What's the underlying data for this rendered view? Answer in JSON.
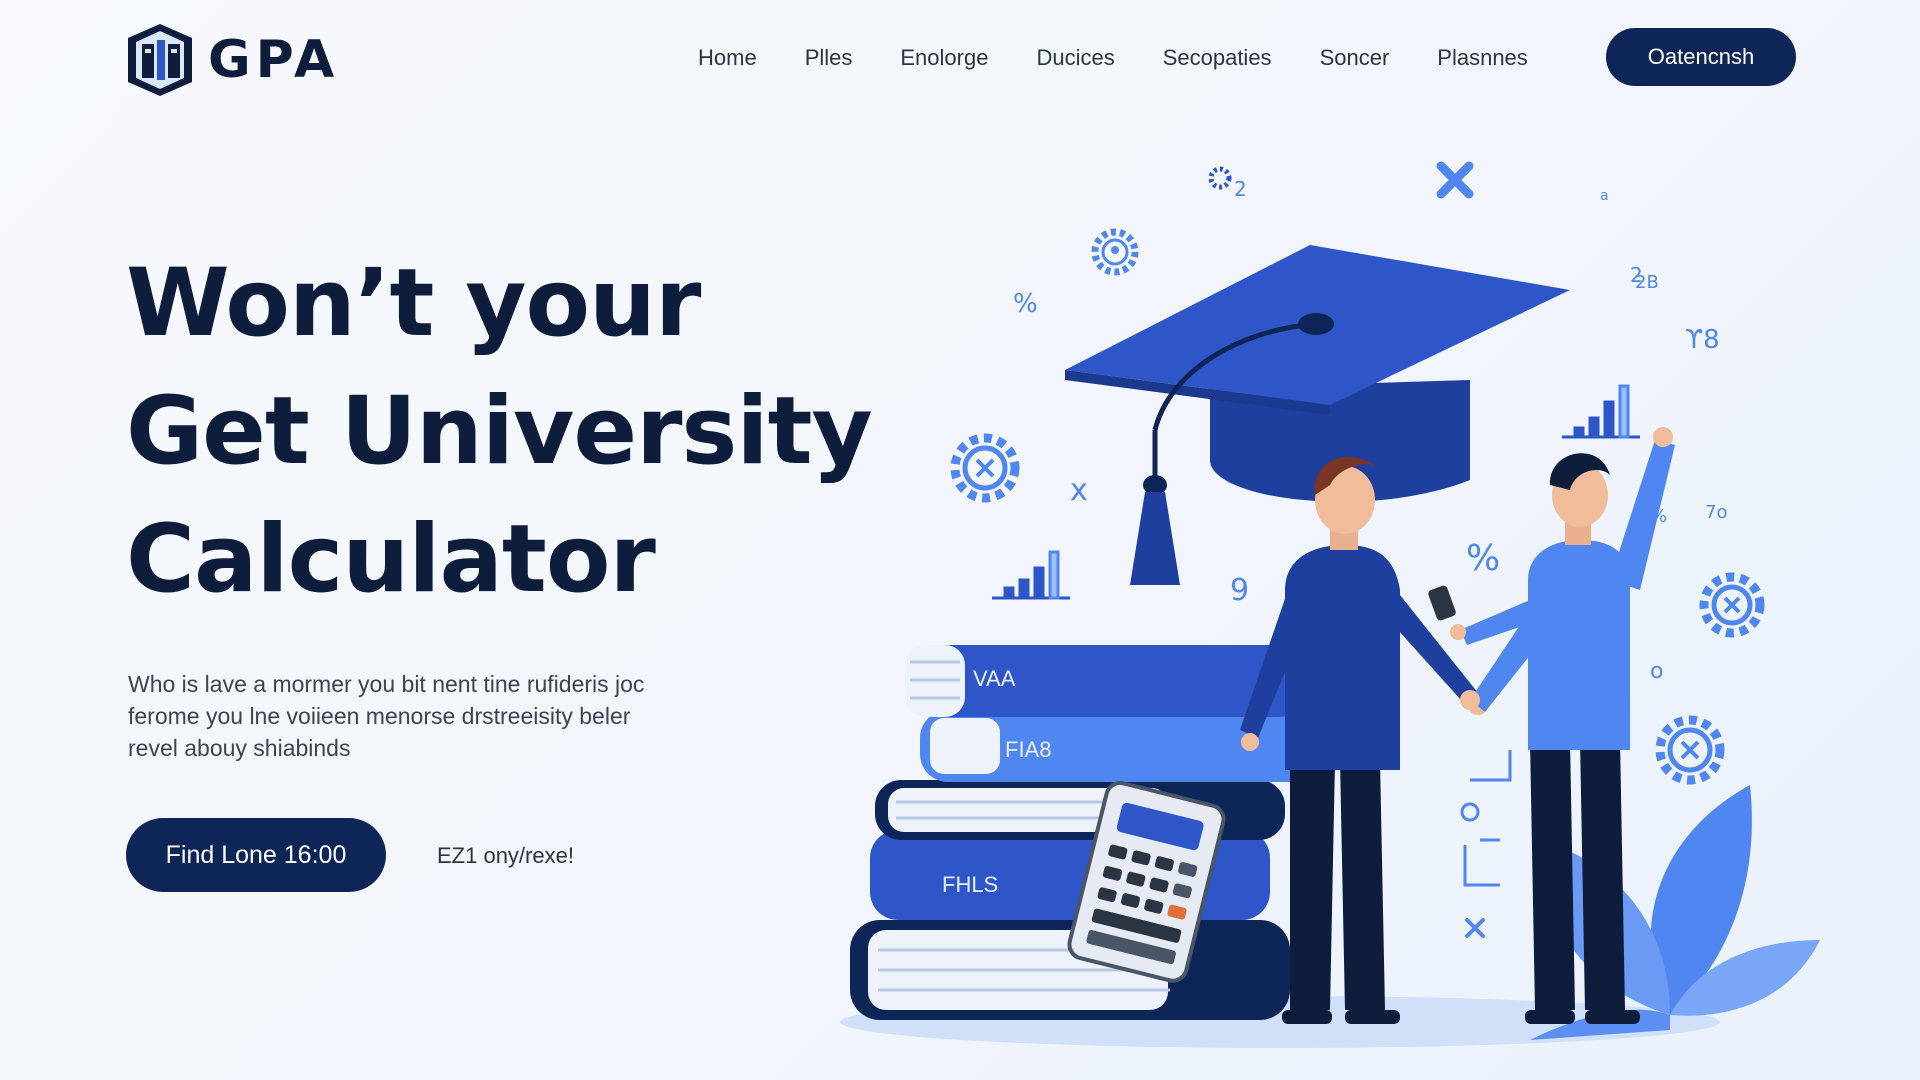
{
  "brand": {
    "name": "GPA"
  },
  "nav": {
    "items": [
      {
        "label": "Home"
      },
      {
        "label": "Plles"
      },
      {
        "label": "Enolorge"
      },
      {
        "label": "Ducices"
      },
      {
        "label": "Secopaties"
      },
      {
        "label": "Soncer"
      },
      {
        "label": "Plasnnes"
      }
    ],
    "cta_label": "Oatencnsh"
  },
  "hero": {
    "title_lines": [
      "Won’t your",
      "Get University",
      "Calculator"
    ],
    "description_lines": [
      "Who is lave a mormer you bit nent tine rufideris joc",
      "ferome you lne voiieen menorse drstreeisity beler",
      "revel abouy shiabinds"
    ],
    "primary_button": "Find Lone 16:00",
    "secondary_link": "EZ1 ony/rexe!"
  },
  "illustration": {
    "book_labels": [
      "VAA",
      "FIA8",
      "FHLS"
    ],
    "floating_symbols": [
      "2",
      "%",
      "%",
      "2",
      "x",
      "%",
      "9",
      "2B",
      "a",
      "ϒ8",
      "7o",
      "o"
    ],
    "colors": {
      "navy": "#0e2557",
      "royal_blue": "#2f56c8",
      "light_blue": "#4f86f0",
      "pale_blue": "#cfe0f8"
    }
  }
}
